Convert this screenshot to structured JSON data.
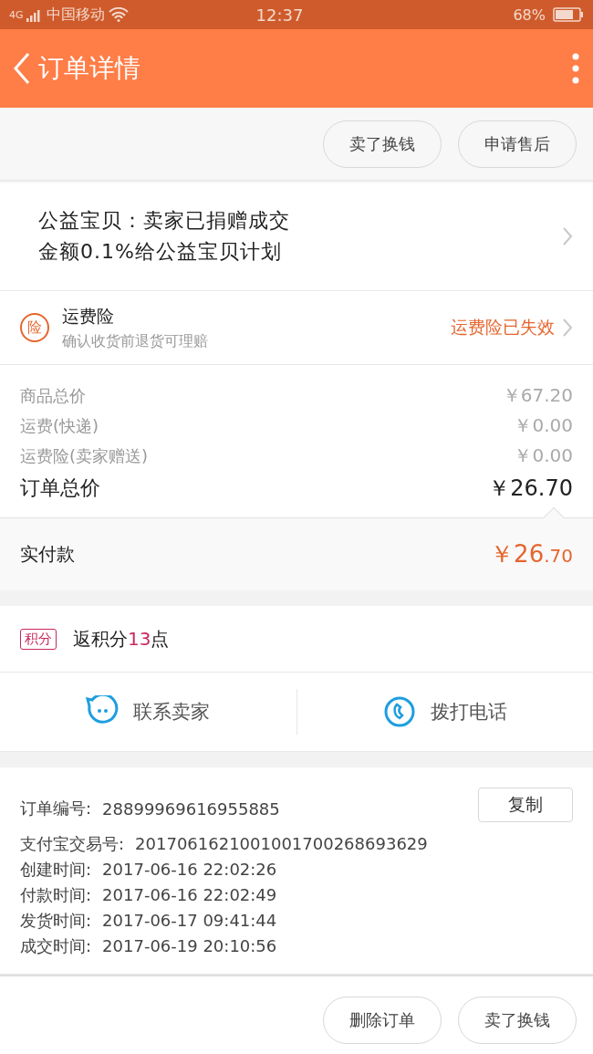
{
  "status_bar": {
    "network": "4G",
    "carrier": "中国移动",
    "time": "12:37",
    "battery": "68%"
  },
  "header": {
    "title": "订单详情"
  },
  "top_actions": [
    "卖了换钱",
    "申请售后"
  ],
  "charity": {
    "text": "公益宝贝：卖家已捐赠成交金额0.1%给公益宝贝计划"
  },
  "insurance": {
    "badge": "险",
    "title": "运费险",
    "subtitle": "确认收货前退货可理赔",
    "status": "运费险已失效"
  },
  "prices": [
    {
      "kind": "minor",
      "label": "商品总价",
      "value": "￥67.20"
    },
    {
      "kind": "minor",
      "label": "运费(快递)",
      "value": "￥0.00"
    },
    {
      "kind": "minor",
      "label": "运费险(卖家赠送)",
      "value": "￥0.00"
    },
    {
      "kind": "total",
      "label": "订单总价",
      "value": "￥26.70"
    }
  ],
  "paid": {
    "label": "实付款",
    "currency": "￥",
    "integer": "26",
    "decimal": ".70"
  },
  "points": {
    "tag": "积分",
    "prefix": "返积分",
    "value": "13",
    "suffix": "点"
  },
  "contact": [
    {
      "kind": "chat",
      "label": "联系卖家"
    },
    {
      "kind": "phone",
      "label": "拨打电话"
    }
  ],
  "order_info": {
    "copy_button": "复制",
    "rows": [
      {
        "label": "订单编号:",
        "value": "28899969616955885"
      },
      {
        "label": "支付宝交易号:",
        "value": "2017061621001001700268693629"
      },
      {
        "label": "创建时间:",
        "value": "2017-06-16 22:02:26"
      },
      {
        "label": "付款时间:",
        "value": "2017-06-16 22:02:49"
      },
      {
        "label": "发货时间:",
        "value": "2017-06-17 09:41:44"
      },
      {
        "label": "成交时间:",
        "value": "2017-06-19 20:10:56"
      }
    ]
  },
  "bottom_actions": [
    "删除订单",
    "卖了换钱"
  ]
}
